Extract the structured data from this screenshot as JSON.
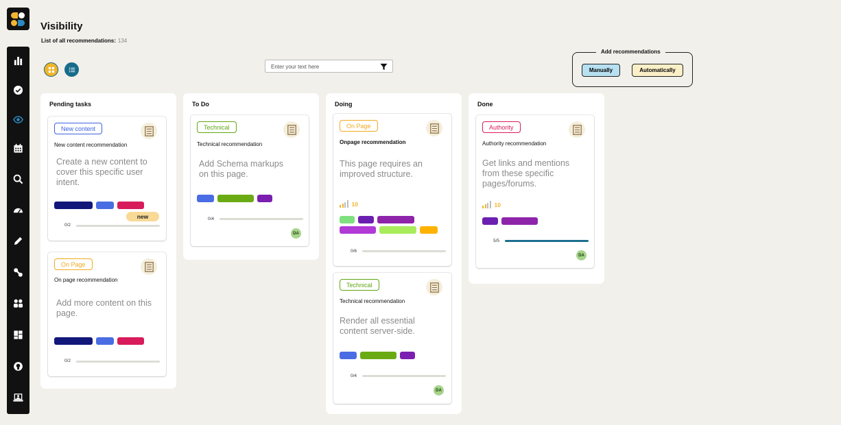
{
  "app": {
    "sidebar_icons": [
      "chart-bar-icon",
      "check-circle-icon",
      "eye-icon",
      "calendar-icon",
      "search-icon",
      "gauge-icon",
      "pencil-icon",
      "link-icon",
      "users-icon",
      "dashboard-icon",
      "lightbulb-icon",
      "user-laptop-icon"
    ],
    "active_icon": "eye-icon",
    "accent": "#176c8b"
  },
  "header": {
    "title": "Visibility",
    "subtitle": "List of all recommendations:",
    "count": "134"
  },
  "search": {
    "placeholder": "Enter your text here"
  },
  "add": {
    "legend": "Add recommendations",
    "manual": "Manually",
    "auto": "Automatically"
  },
  "columns": [
    {
      "title": "Pending tasks",
      "cards": [
        {
          "tag": "New content",
          "tag_color": "#3a63e0",
          "title": "New content recommendation",
          "desc": [
            "Create a new content to",
            "cover this specific user",
            "intent."
          ],
          "chips": [
            "#12177a",
            "#4a6de3",
            "#d81b5a"
          ],
          "badge": "new",
          "progress": "0/2",
          "progress_value": 0
        },
        {
          "tag": "On Page",
          "tag_color": "#f0a91e",
          "title": "On page recommendation",
          "desc": [
            "Add more content on this",
            "page."
          ],
          "chips": [
            "#12177a",
            "#4a6de3",
            "#d81b5a"
          ],
          "progress": "0/2",
          "progress_value": 0
        }
      ]
    },
    {
      "title": "To Do",
      "cards": [
        {
          "tag": "Technical",
          "tag_color": "#5fa612",
          "title": "Technical recommendation",
          "desc": [
            "Add Schema markups",
            "on this page."
          ],
          "chips": [
            "#4a6de3",
            "#6aab14",
            "#7b1fb0"
          ],
          "progress": "0/4",
          "progress_value": 0,
          "avatar": "DA"
        }
      ]
    },
    {
      "title": "Doing",
      "cards": [
        {
          "tag": "On Page",
          "tag_color": "#f0a91e",
          "title": "Onpage recommendation",
          "desc": [
            "This page requires an",
            "improved structure."
          ],
          "score": "10",
          "chips": [
            "#7fe07f",
            "#6b1fb0",
            "#8e24aa",
            "#b13ad6",
            "#a8ec5c",
            "#ffb300"
          ],
          "progress": "0/6",
          "progress_value": 0
        },
        {
          "tag": "Technical",
          "tag_color": "#5fa612",
          "title": "Technical recommendation",
          "desc": [
            "Render all essential",
            "content server-side."
          ],
          "chips": [
            "#4a6de3",
            "#6aab14",
            "#7b1fb0"
          ],
          "progress": "0/4",
          "progress_value": 0,
          "avatar": "DA"
        }
      ]
    },
    {
      "title": "Done",
      "cards": [
        {
          "tag": "Authority",
          "tag_color": "#d81b5a",
          "title": "Authority recommendation",
          "desc": [
            "Get links and mentions",
            "from these specific",
            "pages/forums."
          ],
          "score": "10",
          "chips": [
            "#6b1fb0",
            "#8e24aa"
          ],
          "progress": "5/5",
          "progress_value": 1,
          "avatar": "DA"
        }
      ]
    }
  ]
}
